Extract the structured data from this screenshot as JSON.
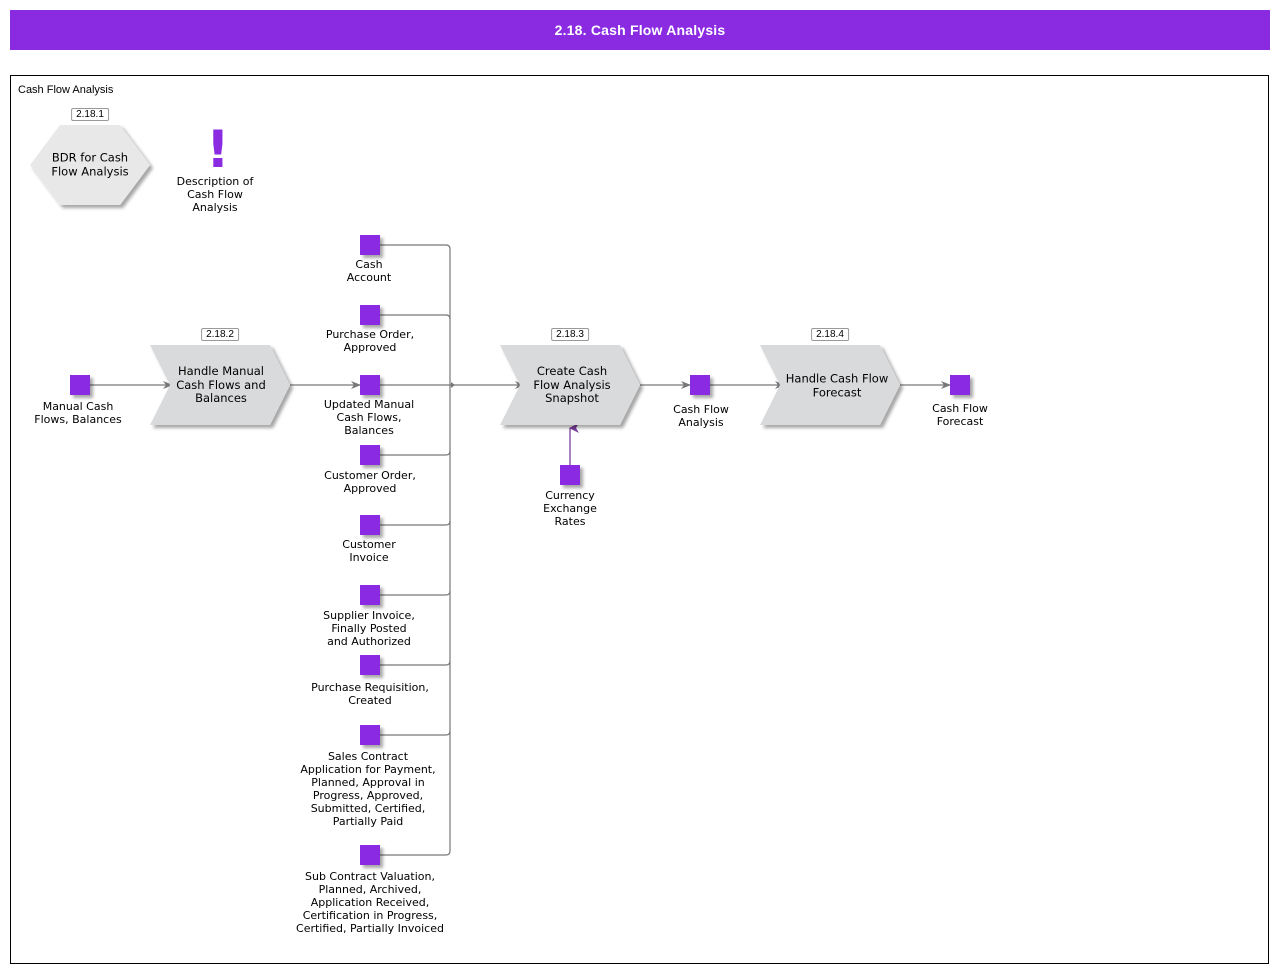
{
  "header": {
    "title": "2.18. Cash Flow Analysis"
  },
  "frame": {
    "label": "Cash Flow Analysis"
  },
  "colors": {
    "accent": "#8a2be2",
    "process_fill": "#d9dadb",
    "hex_fill": "#e8e8e8",
    "connector": "#777777",
    "input_connector": "#7b3f9e"
  },
  "processes": [
    {
      "id": "p1",
      "number": "2.18.1",
      "label": "BDR for Cash\nFlow Analysis",
      "shape": "hexagon"
    },
    {
      "id": "p2",
      "number": "2.18.2",
      "label": "Handle Manual\nCash Flows and\nBalances",
      "shape": "chevron"
    },
    {
      "id": "p3",
      "number": "2.18.3",
      "label": "Create Cash\nFlow Analysis\nSnapshot",
      "shape": "chevron"
    },
    {
      "id": "p4",
      "number": "2.18.4",
      "label": "Handle Cash Flow\nForecast",
      "shape": "chevron"
    }
  ],
  "description": {
    "icon": "exclamation-icon",
    "label": "Description of\nCash Flow\nAnalysis"
  },
  "objects": [
    {
      "id": "o_manual",
      "label": "Manual Cash\nFlows, Balances"
    },
    {
      "id": "o_cash_account",
      "label": "Cash\nAccount"
    },
    {
      "id": "o_po",
      "label": "Purchase Order,\nApproved"
    },
    {
      "id": "o_updated",
      "label": "Updated Manual\nCash Flows,\nBalances"
    },
    {
      "id": "o_co",
      "label": "Customer Order,\nApproved"
    },
    {
      "id": "o_ci",
      "label": "Customer\nInvoice"
    },
    {
      "id": "o_si",
      "label": "Supplier Invoice,\nFinally Posted\nand Authorized"
    },
    {
      "id": "o_pr",
      "label": "Purchase Requisition,\nCreated"
    },
    {
      "id": "o_sc",
      "label": "Sales Contract\nApplication for Payment,\nPlanned, Approval in\nProgress, Approved,\nSubmitted, Certified,\nPartially Paid"
    },
    {
      "id": "o_sub",
      "label": "Sub Contract Valuation,\nPlanned, Archived,\nApplication Received,\nCertification in Progress,\nCertified, Partially Invoiced"
    },
    {
      "id": "o_fx",
      "label": "Currency\nExchange\nRates"
    },
    {
      "id": "o_cfa",
      "label": "Cash Flow\nAnalysis"
    },
    {
      "id": "o_cff",
      "label": "Cash Flow\nForecast"
    }
  ],
  "flows": [
    {
      "from": "Manual Cash Flows, Balances",
      "to": "Handle Manual Cash Flows and Balances"
    },
    {
      "from": "Handle Manual Cash Flows and Balances",
      "to": "Updated Manual Cash Flows, Balances"
    },
    {
      "from": "Cash Account",
      "to": "Create Cash Flow Analysis Snapshot"
    },
    {
      "from": "Purchase Order, Approved",
      "to": "Create Cash Flow Analysis Snapshot"
    },
    {
      "from": "Updated Manual Cash Flows, Balances",
      "to": "Create Cash Flow Analysis Snapshot"
    },
    {
      "from": "Customer Order, Approved",
      "to": "Create Cash Flow Analysis Snapshot"
    },
    {
      "from": "Customer Invoice",
      "to": "Create Cash Flow Analysis Snapshot"
    },
    {
      "from": "Supplier Invoice, Finally Posted and Authorized",
      "to": "Create Cash Flow Analysis Snapshot"
    },
    {
      "from": "Purchase Requisition, Created",
      "to": "Create Cash Flow Analysis Snapshot"
    },
    {
      "from": "Sales Contract Application for Payment",
      "to": "Create Cash Flow Analysis Snapshot"
    },
    {
      "from": "Sub Contract Valuation",
      "to": "Create Cash Flow Analysis Snapshot"
    },
    {
      "from": "Currency Exchange Rates",
      "to": "Create Cash Flow Analysis Snapshot"
    },
    {
      "from": "Create Cash Flow Analysis Snapshot",
      "to": "Cash Flow Analysis"
    },
    {
      "from": "Cash Flow Analysis",
      "to": "Handle Cash Flow Forecast"
    },
    {
      "from": "Handle Cash Flow Forecast",
      "to": "Cash Flow Forecast"
    }
  ]
}
